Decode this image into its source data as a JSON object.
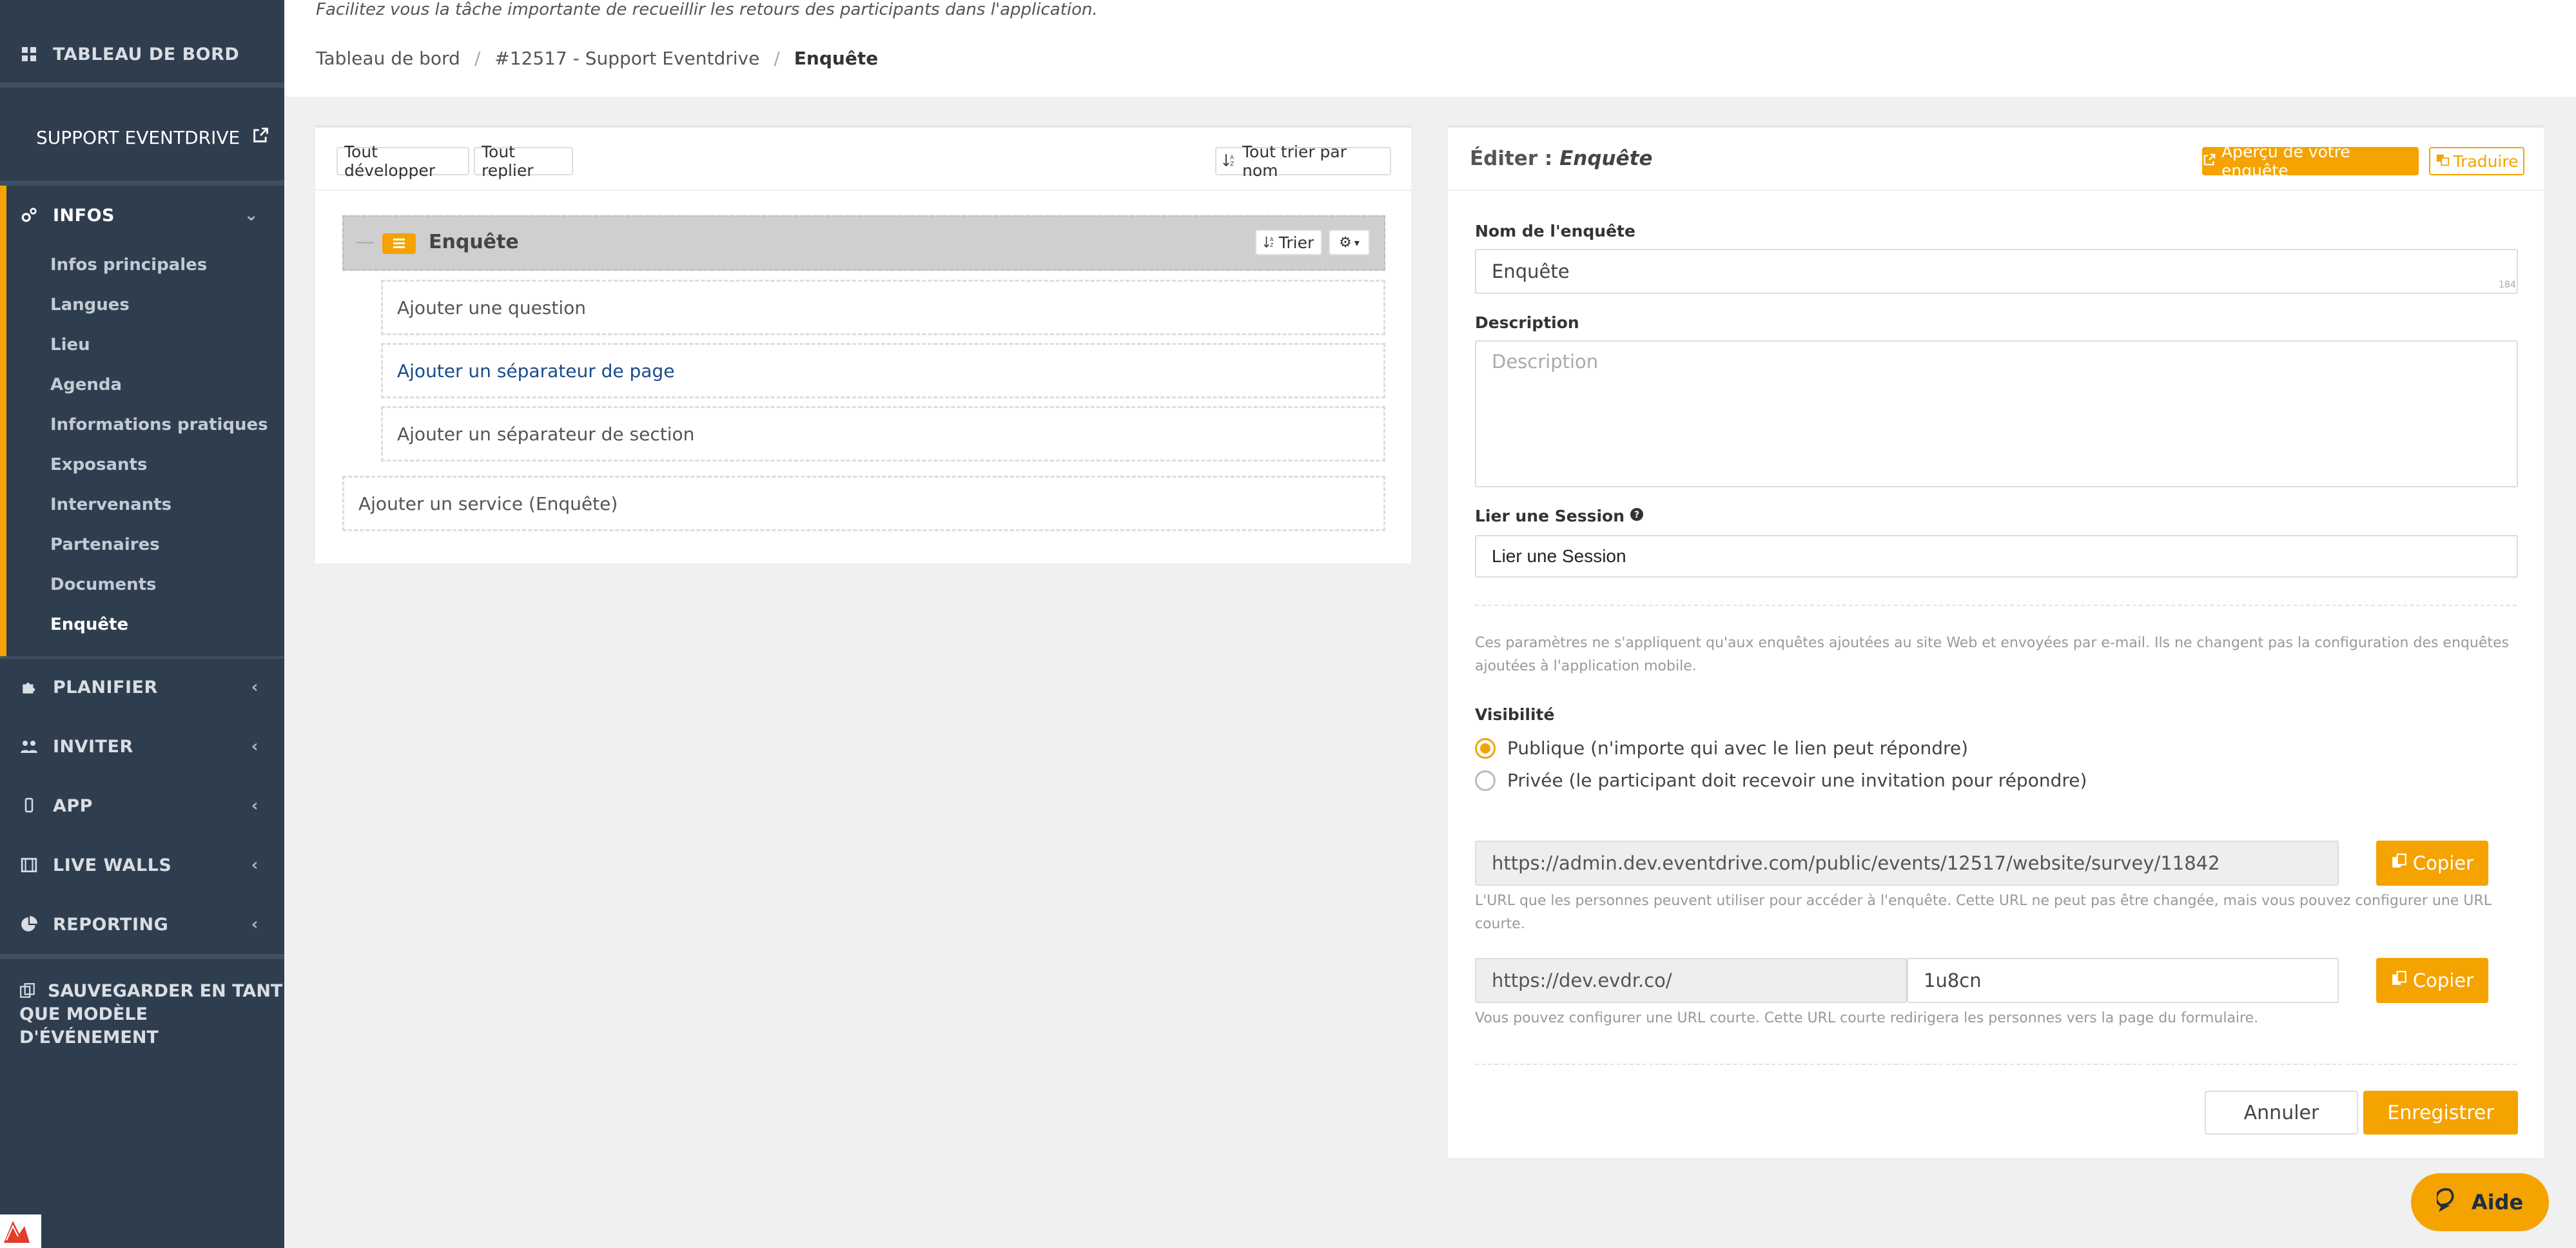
{
  "sidebar": {
    "dashboard": "TABLEAU DE BORD",
    "support": "SUPPORT EVENTDRIVE",
    "infos": "INFOS",
    "infos_items": [
      "Infos principales",
      "Langues",
      "Lieu",
      "Agenda",
      "Informations pratiques",
      "Exposants",
      "Intervenants",
      "Partenaires",
      "Documents",
      "Enquête"
    ],
    "planifier": "PLANIFIER",
    "inviter": "INVITER",
    "app": "APP",
    "live_walls": "LIVE WALLS",
    "reporting": "REPORTING",
    "save_model_line1": "SAUVEGARDER EN TANT",
    "save_model_line2": "QUE MODÈLE D'ÉVÉNEMENT"
  },
  "header": {
    "subtitle": "Facilitez vous la tâche importante de recueillir les retours des participants dans l'application.",
    "breadcrumb": [
      "Tableau de bord",
      "#12517 - Support Eventdrive",
      "Enquête"
    ]
  },
  "tree": {
    "expand_all": "Tout développer",
    "collapse_all": "Tout replier",
    "sort_all": "Tout trier par nom",
    "node_title": "Enquête",
    "sort_label": "Trier",
    "add_question": "Ajouter une question",
    "add_page_separator": "Ajouter un séparateur de page",
    "add_section_separator": "Ajouter un séparateur de section",
    "add_service": "Ajouter un service (Enquête)"
  },
  "editor": {
    "title_prefix": "Éditer :",
    "title_name": "Enquête",
    "preview_button": "Aperçu de votre enquête",
    "translate_button": "Traduire",
    "name_label": "Nom de l'enquête",
    "name_value": "Enquête",
    "name_counter": "184",
    "description_label": "Description",
    "description_placeholder": "Description",
    "session_label": "Lier une Session",
    "session_value": "Lier une Session",
    "params_note": "Ces paramètres ne s'appliquent qu'aux enquêtes ajoutées au site Web et envoyées par e-mail. Ils ne changent pas la configuration des enquêtes ajoutées à l'application mobile.",
    "visibility_label": "Visibilité",
    "visibility_public": "Publique (n'importe qui avec le lien peut répondre)",
    "visibility_private": "Privée (le participant doit recevoir une invitation pour répondre)",
    "url_full": "https://admin.dev.eventdrive.com/public/events/12517/website/survey/11842",
    "copy_label": "Copier",
    "url_full_help": "L'URL que les personnes peuvent utiliser pour accéder à l'enquête. Cette URL ne peut pas être changée, mais vous pouvez configurer une URL courte.",
    "short_prefix": "https://dev.evdr.co/",
    "short_value": "1u8cn",
    "short_help": "Vous pouvez configurer une URL courte. Cette URL courte redirigera les personnes vers la page du formulaire.",
    "cancel": "Annuler",
    "save": "Enregistrer"
  },
  "help_button": "Aide",
  "colors": {
    "accent": "#f5a300",
    "sidebar_bg": "#2f3e4f"
  }
}
